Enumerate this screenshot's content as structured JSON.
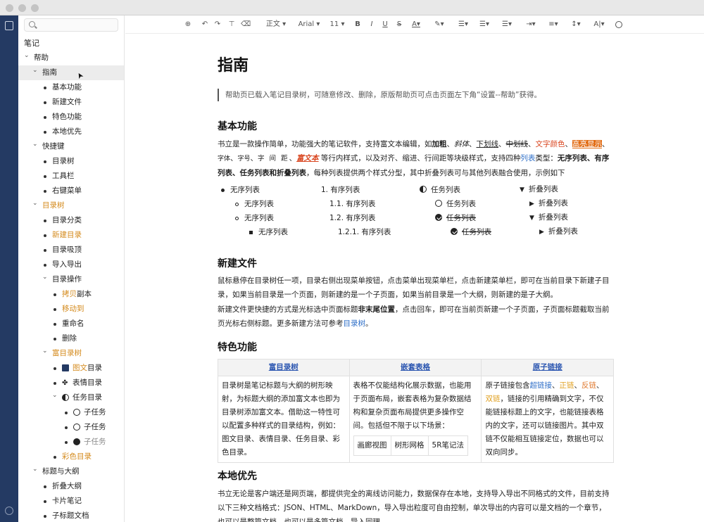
{
  "window": {
    "title": ""
  },
  "sidebar": {
    "search_placeholder": "",
    "root": "笔记",
    "items": [
      {
        "label": "帮助",
        "level": 0,
        "type": "caret-open"
      },
      {
        "label": "指南",
        "level": 1,
        "type": "caret-open",
        "selected": true
      },
      {
        "label": "基本功能",
        "level": 2,
        "type": "dot"
      },
      {
        "label": "新建文件",
        "level": 2,
        "type": "dot"
      },
      {
        "label": "特色功能",
        "level": 2,
        "type": "dot"
      },
      {
        "label": "本地优先",
        "level": 2,
        "type": "dot"
      },
      {
        "label": "快捷键",
        "level": 1,
        "type": "caret-open"
      },
      {
        "label": "目录树",
        "level": 2,
        "type": "dot"
      },
      {
        "label": "工具栏",
        "level": 2,
        "type": "dot"
      },
      {
        "label": "右键菜单",
        "level": 2,
        "type": "dot"
      },
      {
        "label": "目录树",
        "level": 1,
        "type": "caret-open",
        "color": "orange"
      },
      {
        "label": "目录分类",
        "level": 2,
        "type": "dot"
      },
      {
        "label": "新建目录",
        "level": 2,
        "type": "dot",
        "color": "orange"
      },
      {
        "label": "目录吸顶",
        "level": 2,
        "type": "dot"
      },
      {
        "label": "导入导出",
        "level": 2,
        "type": "dot"
      },
      {
        "label": "目录操作",
        "level": 2,
        "type": "caret-open"
      },
      {
        "label_parts": [
          {
            "t": "拷贝",
            "c": "orange"
          },
          {
            "t": "副本"
          }
        ],
        "level": 3,
        "type": "dot"
      },
      {
        "label": "移动到",
        "level": 3,
        "type": "dot",
        "color": "orange"
      },
      {
        "label": "重命名",
        "level": 3,
        "type": "dot"
      },
      {
        "label": "删除",
        "level": 3,
        "type": "dot"
      },
      {
        "label": "富目录树",
        "level": 2,
        "type": "caret-open",
        "color": "orange"
      },
      {
        "label_parts": [
          {
            "t": "图文",
            "c": "orange"
          },
          {
            "t": "目录"
          }
        ],
        "level": 3,
        "type": "dot",
        "icon": "image-icon"
      },
      {
        "label": "表情目录",
        "level": 3,
        "type": "dot",
        "icon": "smile-icon"
      },
      {
        "label": "任务目录",
        "level": 3,
        "type": "caret-open",
        "icon": "half-circle-icon"
      },
      {
        "label": "子任务",
        "level": 4,
        "type": "dot",
        "icon": "empty-circle-icon"
      },
      {
        "label": "子任务",
        "level": 4,
        "type": "dot",
        "icon": "empty-circle-icon"
      },
      {
        "label": "子任务",
        "level": 4,
        "type": "dot",
        "icon": "check-circle-icon",
        "muted": true
      },
      {
        "label": "彩色目录",
        "level": 3,
        "type": "dot",
        "color": "orange"
      },
      {
        "label": "标题与大纲",
        "level": 1,
        "type": "caret-open"
      },
      {
        "label": "折叠大纲",
        "level": 2,
        "type": "dot"
      },
      {
        "label": "卡片笔记",
        "level": 2,
        "type": "dot"
      },
      {
        "label": "子标题文档",
        "level": 2,
        "type": "dot"
      }
    ]
  },
  "toolbar": {
    "style_select": "正文",
    "font_select": "Arial",
    "size_select": "11",
    "icons": [
      "add-circle-icon",
      "undo-icon",
      "redo-icon",
      "format-painter-icon",
      "eraser-icon",
      "bold-icon",
      "italic-icon",
      "underline-icon",
      "strikethrough-icon",
      "font-color-icon",
      "highlight-icon",
      "bullet-list-icon",
      "ordered-list-icon",
      "task-list-icon",
      "indent-icon",
      "align-icon",
      "line-height-icon",
      "letter-spacing-icon",
      "search-icon"
    ],
    "bold": "B",
    "italic": "I",
    "underline": "U",
    "strike": "S",
    "fontcolor": "A",
    "spacing": "A|"
  },
  "doc": {
    "title": "指南",
    "quote": "帮助页已载入笔记目录树，可随意修改、删除，原版帮助页可点击页面左下角“设置--帮助”获得。",
    "s1": {
      "heading": "基本功能",
      "p1a": "书立是一款操作简单，功能强大的笔记软件，支持富文本编辑，如",
      "bold": "加粗",
      "sep": "、",
      "italic": "斜体",
      "underline": "下划线",
      "strike": "中划线",
      "color": "文字颜色",
      "highlight": "高亮显示",
      "font": "字体",
      "size": "字号",
      "spacing": "字 间 距",
      "rich": "富文本",
      "p1b": " 等行内样式，以及对齐、缩进、行间距等块级样式，支持四种",
      "list_link": "列表",
      "p1c": "类型：",
      "types": "无序列表、有序列表、任务列表和折叠列表",
      "p1d": "，每种列表提供两个样式分型，其中折叠列表可与其他列表融合使用，示例如下"
    },
    "lists": {
      "unordered": [
        "无序列表",
        "无序列表",
        "无序列表",
        "无序列表"
      ],
      "ordered": [
        "1. 有序列表",
        "1.1. 有序列表",
        "1.2. 有序列表",
        "1.2.1. 有序列表"
      ],
      "task": [
        "任务列表",
        "任务列表",
        "任务列表",
        "任务列表"
      ],
      "fold": [
        "折叠列表",
        "折叠列表",
        "折叠列表",
        "折叠列表"
      ]
    },
    "s2": {
      "heading": "新建文件",
      "p1": "鼠标悬停在目录树任一项，目录右侧出现菜单按钮，点击菜单出现菜单栏，点击新建菜单栏，即可在当前目录下新建子目录，如果当前目录是一个页面，则新建的是一个子页面，如果当前目录是一个大纲，则新建的是子大纲。",
      "p2a": "新建文件更快捷的方式是光标选中页面标题",
      "p2b": "非末尾位置",
      "p2c": "，点击回车，即可在当前页新建一个子页面，子页面标题截取当前页光标右侧标题。更多新建方法可参考",
      "p2link": "目录树",
      "p2d": "。"
    },
    "s3": {
      "heading": "特色功能",
      "cols": [
        "富目录树",
        "嵌套表格",
        "原子链接"
      ],
      "c1": "目录树是笔记标题与大纲的树形映射，为标题大纲的添加富文本也即为目录树添加富文本。借助这一特性可以配置多种样式的目录结构，例如：图文目录、表情目录、任务目录、彩色目录。",
      "c2": "表格不仅能结构化展示数据，也能用于页面布局，嵌套表格为复杂数据结构和复杂页面布局提供更多操作空间。包括但不限于以下场景：",
      "c2_inner": [
        "画廊视图",
        "树形网格",
        "5R笔记法"
      ],
      "c3a": "原子链接包含",
      "c3_links": [
        "超链接",
        "正链",
        "反链",
        "双链"
      ],
      "c3b": "，链接的引用精确到文字，不仅能链接标题上的文字，也能链接表格内的文字，还可以链接图片。其中双链不仅能相互链接定位，数据也可以双向同步。"
    },
    "s4": {
      "heading": "本地优先",
      "p1": "书立无论是客户端还是网页端，都提供完全的离线访问能力，数据保存在本地，支持导入导出不同格式的文件，目前支持以下三种文档格式：JSON、HTML、MarkDown，导入导出粒度可自由控制，单次导出的内容可以是文档的一个章节，也可以是整篇文档，也可以是多篇文档，导入同理。"
    }
  },
  "colors": {
    "rail": "#243a63",
    "accent_orange": "#d48a1c",
    "link_blue": "#2f6fc8",
    "highlight": "#e26a10",
    "rich_red": "#d9451f"
  }
}
